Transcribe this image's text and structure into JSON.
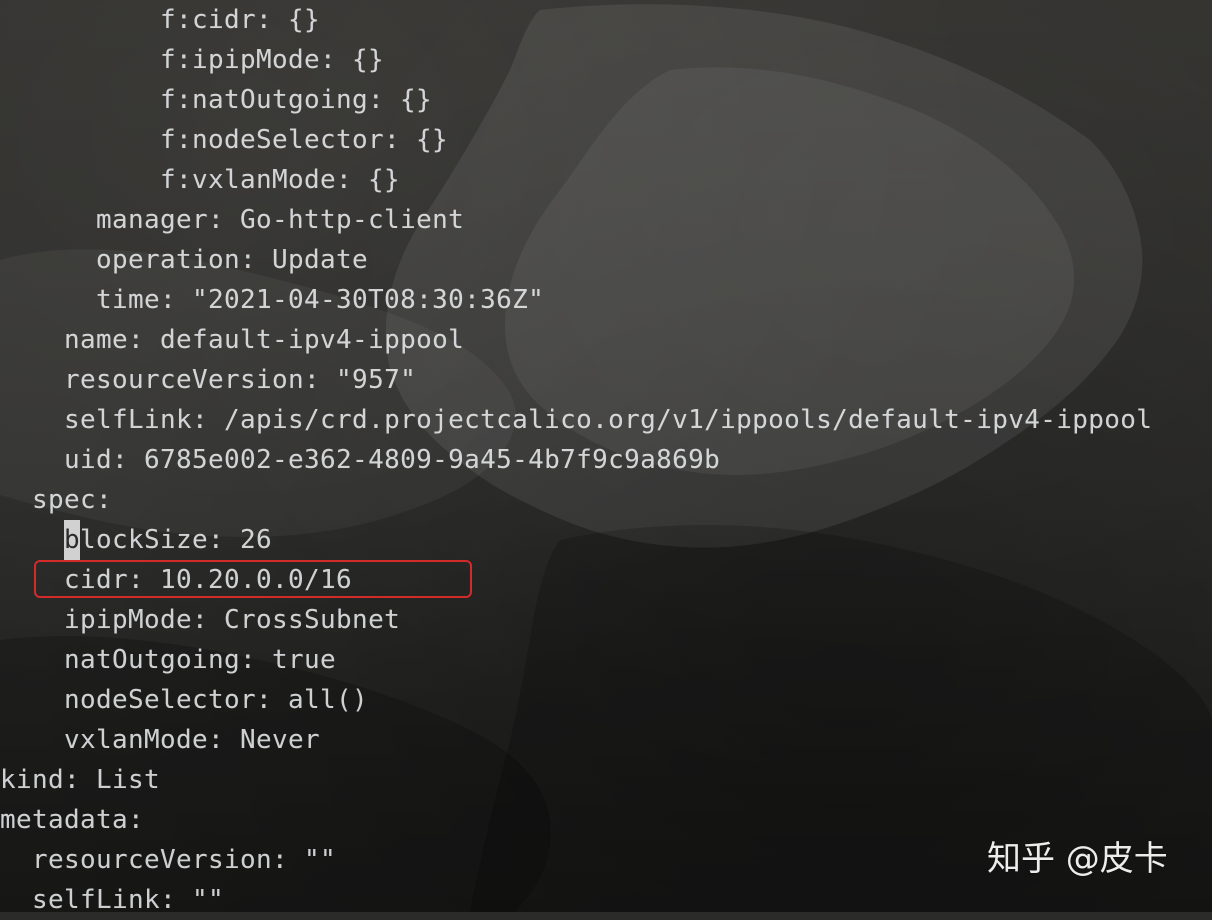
{
  "terminal": {
    "lines": [
      "f:cidr: {}",
      "f:ipipMode: {}",
      "f:natOutgoing: {}",
      "f:nodeSelector: {}",
      "f:vxlanMode: {}",
      "manager: Go-http-client",
      "operation: Update",
      "time: \"2021-04-30T08:30:36Z\"",
      "name: default-ipv4-ippool",
      "resourceVersion: \"957\"",
      "selfLink: /apis/crd.projectcalico.org/v1/ippools/default-ipv4-ippool",
      "uid: 6785e002-e362-4809-9a45-4b7f9c9a869b",
      "spec:",
      "lockSize: 26",
      "cidr: 10.20.0.0/16",
      "ipipMode: CrossSubnet",
      "natOutgoing: true",
      "nodeSelector: all()",
      "vxlanMode: Never",
      "kind: List",
      "metadata:",
      "resourceVersion: \"\"",
      "selfLink: \"\""
    ],
    "cursor_char": "b",
    "highlighted_line": "cidr: 10.20.0.0/16"
  },
  "watermark": {
    "text": "知乎 @皮卡"
  },
  "colors": {
    "background": "#2b2b2a",
    "text": "#e9ebee",
    "highlight_border": "#d32a2a"
  }
}
